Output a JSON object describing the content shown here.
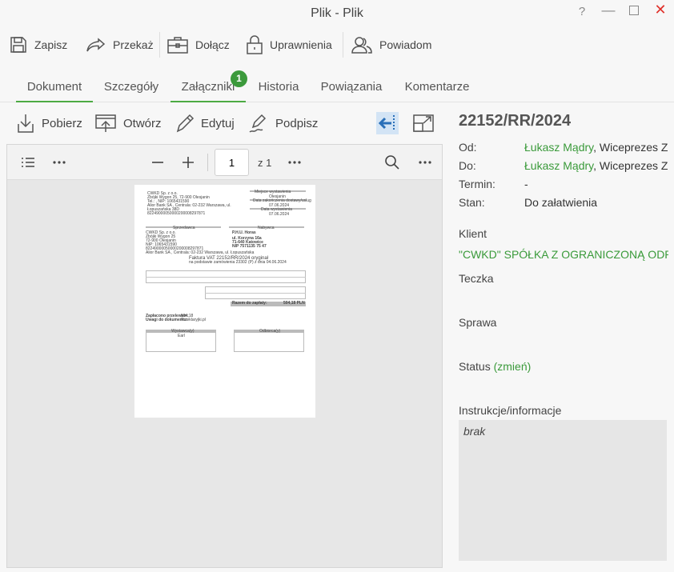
{
  "window": {
    "title": "Plik - Plik",
    "help": "?",
    "minimize": "—",
    "close": "✕"
  },
  "toolbar": {
    "save": "Zapisz",
    "forward": "Przekaż",
    "attach": "Dołącz",
    "permissions": "Uprawnienia",
    "notify": "Powiadom"
  },
  "tabs": [
    {
      "label": "Dokument"
    },
    {
      "label": "Szczegóły"
    },
    {
      "label": "Załączniki"
    },
    {
      "label": "Historia"
    },
    {
      "label": "Powiązania"
    },
    {
      "label": "Komentarze"
    }
  ],
  "attachments_badge": "1",
  "attachment_toolbar": {
    "download": "Pobierz",
    "open": "Otwórz",
    "edit": "Edytuj",
    "sign": "Podpisz"
  },
  "viewer": {
    "page": "1",
    "page_of": "z 1"
  },
  "invoice": {
    "title": "Faktura VAT  22152/RR/2024 oryginał",
    "subtitle": "na podstawie zamówienia 23302 (P) z dnia 04.06.2024",
    "seller_header": "Sprzedawca",
    "buyer_header": "Nabywca",
    "place_header": "Miejsce wystawienia",
    "place": "Olesjanin",
    "sale_date_header": "Data zakończenia dostawy/usług",
    "sale_date": "07.06.2024",
    "issue_date_header": "Data wystawienia",
    "issue_date": "07.06.2024",
    "seller_lines": [
      "CWKD Sp. z o.o.",
      "Zbójki Wygon 25, 72-900 Olesjanin",
      "Tel.: , NIP: 1065431590",
      "Alior Bank SA , Centrala: 02-232 Warszawa, ul.",
      "Łopuszańska 38D",
      "82249000050000200008297871"
    ],
    "buyer_lines": [
      "P.H.U. Horas",
      "ul. Korzyna 16a",
      "71-640 Katowice",
      "NIP 7571135 75 47"
    ],
    "seller2_lines": [
      "CWKD Sp. z o.o.",
      "Zbójki Wygon 25",
      "72-900 Olesjanin",
      "NIP: 1065431590",
      "82249000050000200008297871",
      "Alior Bank SA , Centrala: 02-232 Warszawa, ul. Łopuszańska"
    ],
    "total_label": "Razem do zapłaty:",
    "total": "504,18 PLN",
    "paid_label": "Zapłacono przelewem:",
    "paid": "504,18",
    "agreement_label": "Uwagi do dokumentu:",
    "agreement": "Przeklaryjki.pl",
    "recipient_label": "Odbiorca(y)",
    "issuer_label": "Wystawca(y)",
    "issuer_name": "Earl"
  },
  "details": {
    "number": "22152/RR/2024",
    "from_label": "Od:",
    "from_name": "Łukasz Mądry",
    "from_role": ", Wiceprezes Zarządu",
    "to_label": "Do:",
    "to_name": "Łukasz Mądry",
    "to_role": ", Wiceprezes Zarządu",
    "deadline_label": "Termin:",
    "deadline_value": "-",
    "state_label": "Stan:",
    "state_value": "Do załatwienia",
    "client_label": "Klient",
    "client_value": "\"CWKD\" SPÓŁKA Z OGRANICZONĄ ODPOWIEDZIALNOŚCIĄ",
    "folder_label": "Teczka",
    "case_label": "Sprawa",
    "status_label": "Status",
    "status_change": "(zmień)",
    "instructions_label": "Instrukcje/informacje",
    "instructions_value": "brak"
  },
  "colors": {
    "accent": "#4caa43",
    "link": "#3a9a3a",
    "badge": "#3c9a3c",
    "close": "#e0302a"
  }
}
